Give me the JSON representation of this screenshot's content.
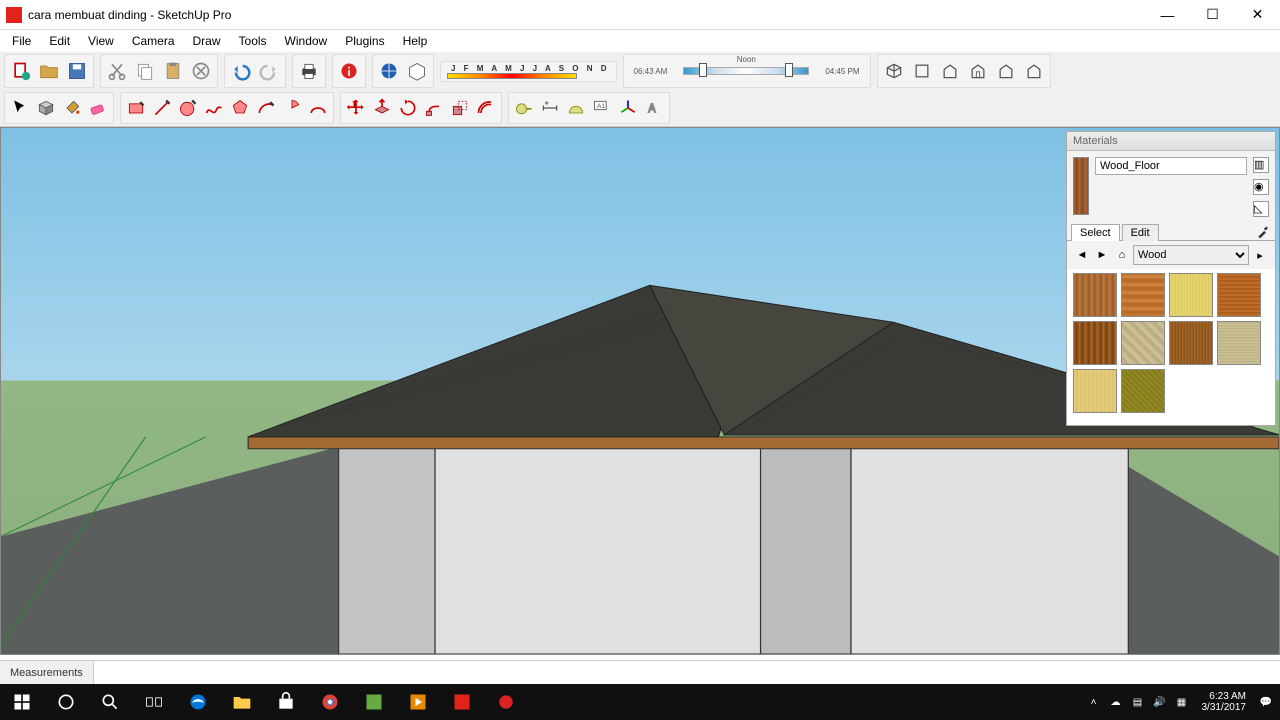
{
  "titlebar": {
    "filename": "cara membuat dinding",
    "app": "SketchUp Pro"
  },
  "menu": [
    "File",
    "Edit",
    "View",
    "Camera",
    "Draw",
    "Tools",
    "Window",
    "Plugins",
    "Help"
  ],
  "shadows": {
    "months": "J F M A M J J A S O N D",
    "time_start": "06:43 AM",
    "noon": "Noon",
    "time_end": "04:45 PM"
  },
  "materials": {
    "title": "Materials",
    "current_name": "Wood_Floor",
    "tabs": {
      "select": "Select",
      "edit": "Edit"
    },
    "library": "Wood",
    "swatches": [
      "wood1",
      "wood2",
      "wood3",
      "wood4",
      "wood5",
      "wood6",
      "wood7",
      "wood8",
      "wood9",
      "wood10"
    ]
  },
  "statusbar": {
    "label": "Measurements"
  },
  "tray": {
    "time": "6:23 AM",
    "date": "3/31/2017"
  }
}
